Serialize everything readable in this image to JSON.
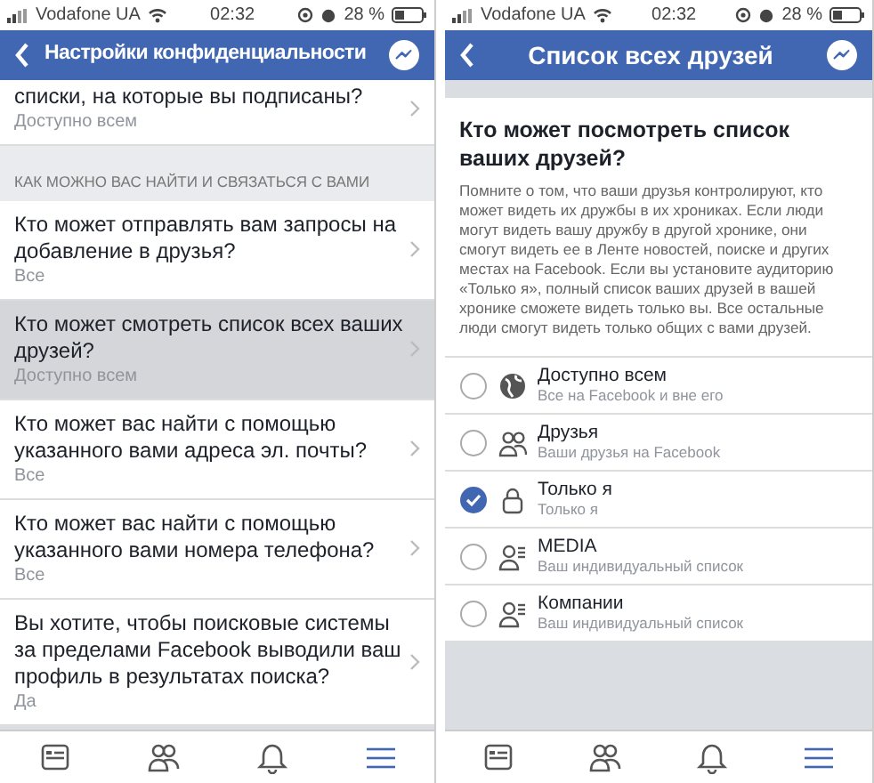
{
  "screens": [
    {
      "kind": "settings",
      "status_bar": {
        "carrier": "Vodafone UA",
        "time": "02:32",
        "battery": "28 %"
      },
      "header": {
        "title": "Настройки конфиденциальности"
      },
      "items": [
        {
          "kind": "setting",
          "title": "списки, на которые вы подписаны?",
          "value": "Доступно всем",
          "selected": false
        },
        {
          "kind": "section",
          "title": "КАК МОЖНО ВАС НАЙТИ И СВЯЗАТЬСЯ С ВАМИ"
        },
        {
          "kind": "setting",
          "title": "Кто может отправлять вам запросы на добавление в друзья?",
          "value": "Все",
          "selected": false
        },
        {
          "kind": "setting",
          "title": "Кто может смотреть список всех ваших друзей?",
          "value": "Доступно всем",
          "selected": true
        },
        {
          "kind": "setting",
          "title": "Кто может вас найти с помощью указанного вами адреса эл. почты?",
          "value": "Все",
          "selected": false
        },
        {
          "kind": "setting",
          "title": "Кто может вас найти с помощью указанного вами номера телефона?",
          "value": "Все",
          "selected": false
        },
        {
          "kind": "setting",
          "title": "Вы хотите, чтобы поисковые системы за пределами Facebook выводили ваш профиль в результатах поиска?",
          "value": "Да",
          "selected": false
        }
      ],
      "tab_bar": [
        {
          "selected": false
        },
        {
          "selected": false
        },
        {
          "selected": false
        },
        {
          "selected": true
        }
      ]
    },
    {
      "kind": "audience",
      "status_bar": {
        "carrier": "Vodafone UA",
        "time": "02:32",
        "battery": "28 %"
      },
      "header": {
        "title": "Список всех друзей"
      },
      "question": {
        "title": "Кто может посмотреть список ваших друзей?",
        "text": "Помните о том, что ваши друзья контролируют, кто может видеть их дружбы в их хрониках. Если люди могут видеть вашу дружбу в другой хронике, они смогут видеть ее в Ленте новостей, поиске и других местах на Facebook. Если вы установите аудиторию «Только я», полный список ваших друзей в вашей хронике сможете видеть только вы. Все остальные люди смогут видеть только общих с вами друзей."
      },
      "options": [
        {
          "kind": "globe",
          "title": "Доступно всем",
          "subtitle": "Все на Facebook и вне его",
          "selected": false
        },
        {
          "kind": "friends",
          "title": "Друзья",
          "subtitle": "Ваши друзья на Facebook",
          "selected": false
        },
        {
          "kind": "lock",
          "title": "Только я",
          "subtitle": "Только я",
          "selected": true
        },
        {
          "kind": "list",
          "title": "MEDIA",
          "subtitle": "Ваш индивидуальный список",
          "selected": false
        },
        {
          "kind": "list",
          "title": "Компании",
          "subtitle": "Ваш индивидуальный список",
          "selected": false
        }
      ],
      "tab_bar": [
        {
          "selected": false
        },
        {
          "selected": false
        },
        {
          "selected": false
        },
        {
          "selected": true
        }
      ]
    }
  ]
}
